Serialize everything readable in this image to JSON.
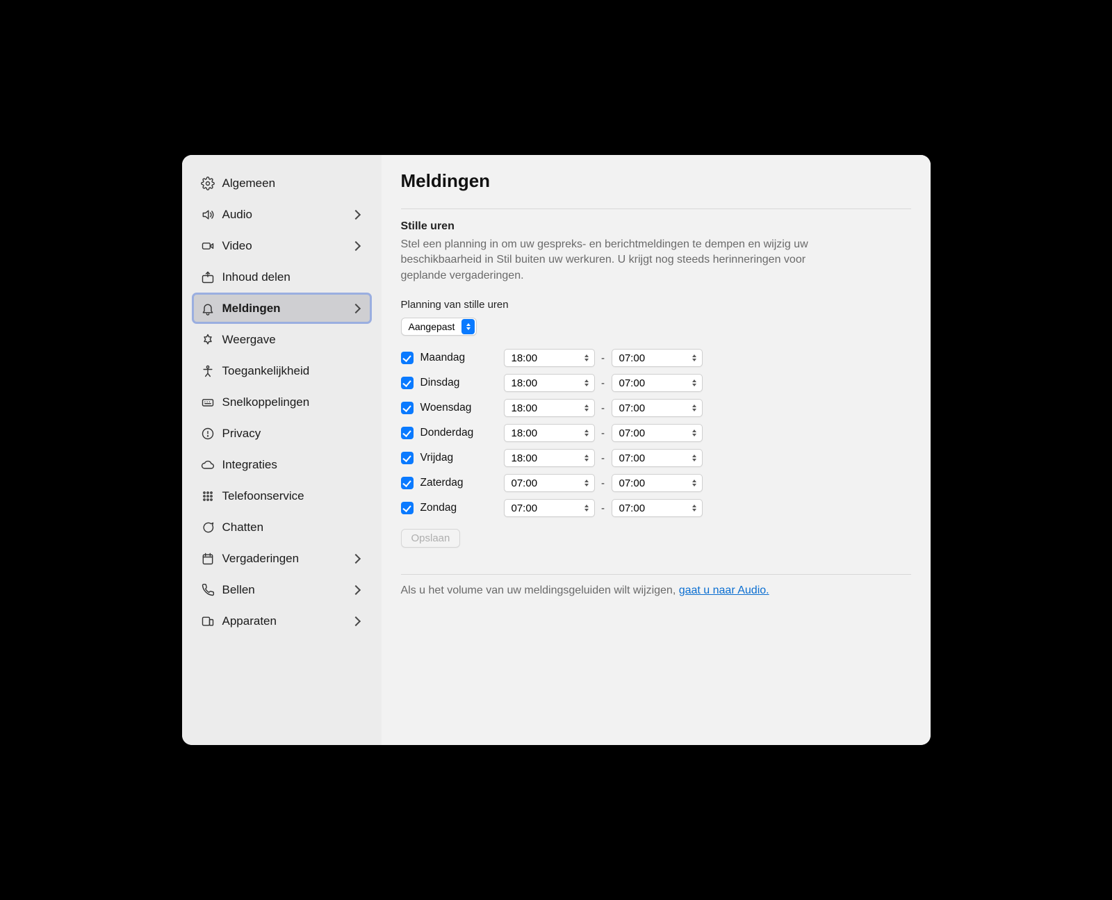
{
  "page": {
    "title": "Meldingen",
    "section_title": "Stille uren",
    "section_desc": "Stel een planning in om uw gespreks- en berichtmeldingen te dempen en wijzig uw beschikbaarheid in Stil buiten uw werkuren. U krijgt nog steeds herinneringen voor geplande vergaderingen.",
    "schedule_label": "Planning van stille uren",
    "schedule_mode": "Aangepast",
    "save_label": "Opslaan",
    "footnote_prefix": "Als u het volume van uw meldingsgeluiden wilt wijzigen, ",
    "footnote_link": "gaat u naar Audio."
  },
  "sidebar": {
    "items": [
      {
        "id": "algemeen",
        "label": "Algemeen",
        "icon": "gear",
        "has_children": false,
        "active": false
      },
      {
        "id": "audio",
        "label": "Audio",
        "icon": "speaker",
        "has_children": true,
        "active": false
      },
      {
        "id": "video",
        "label": "Video",
        "icon": "camera",
        "has_children": true,
        "active": false
      },
      {
        "id": "inhoud-delen",
        "label": "Inhoud delen",
        "icon": "share",
        "has_children": false,
        "active": false
      },
      {
        "id": "meldingen",
        "label": "Meldingen",
        "icon": "bell",
        "has_children": true,
        "active": true
      },
      {
        "id": "weergave",
        "label": "Weergave",
        "icon": "appearance",
        "has_children": false,
        "active": false
      },
      {
        "id": "toegankelijkheid",
        "label": "Toegankelijkheid",
        "icon": "accessibility",
        "has_children": false,
        "active": false
      },
      {
        "id": "snelkoppelingen",
        "label": "Snelkoppelingen",
        "icon": "keyboard",
        "has_children": false,
        "active": false
      },
      {
        "id": "privacy",
        "label": "Privacy",
        "icon": "privacy",
        "has_children": false,
        "active": false
      },
      {
        "id": "integraties",
        "label": "Integraties",
        "icon": "cloud",
        "has_children": false,
        "active": false
      },
      {
        "id": "telefoonservice",
        "label": "Telefoonservice",
        "icon": "dialpad",
        "has_children": false,
        "active": false
      },
      {
        "id": "chatten",
        "label": "Chatten",
        "icon": "chat",
        "has_children": false,
        "active": false
      },
      {
        "id": "vergaderingen",
        "label": "Vergaderingen",
        "icon": "calendar",
        "has_children": true,
        "active": false
      },
      {
        "id": "bellen",
        "label": "Bellen",
        "icon": "phone",
        "has_children": true,
        "active": false
      },
      {
        "id": "apparaten",
        "label": "Apparaten",
        "icon": "devices",
        "has_children": true,
        "active": false
      }
    ]
  },
  "days": [
    {
      "name": "Maandag",
      "enabled": true,
      "from": "18:00",
      "to": "07:00"
    },
    {
      "name": "Dinsdag",
      "enabled": true,
      "from": "18:00",
      "to": "07:00"
    },
    {
      "name": "Woensdag",
      "enabled": true,
      "from": "18:00",
      "to": "07:00"
    },
    {
      "name": "Donderdag",
      "enabled": true,
      "from": "18:00",
      "to": "07:00"
    },
    {
      "name": "Vrijdag",
      "enabled": true,
      "from": "18:00",
      "to": "07:00"
    },
    {
      "name": "Zaterdag",
      "enabled": true,
      "from": "07:00",
      "to": "07:00"
    },
    {
      "name": "Zondag",
      "enabled": true,
      "from": "07:00",
      "to": "07:00"
    }
  ]
}
